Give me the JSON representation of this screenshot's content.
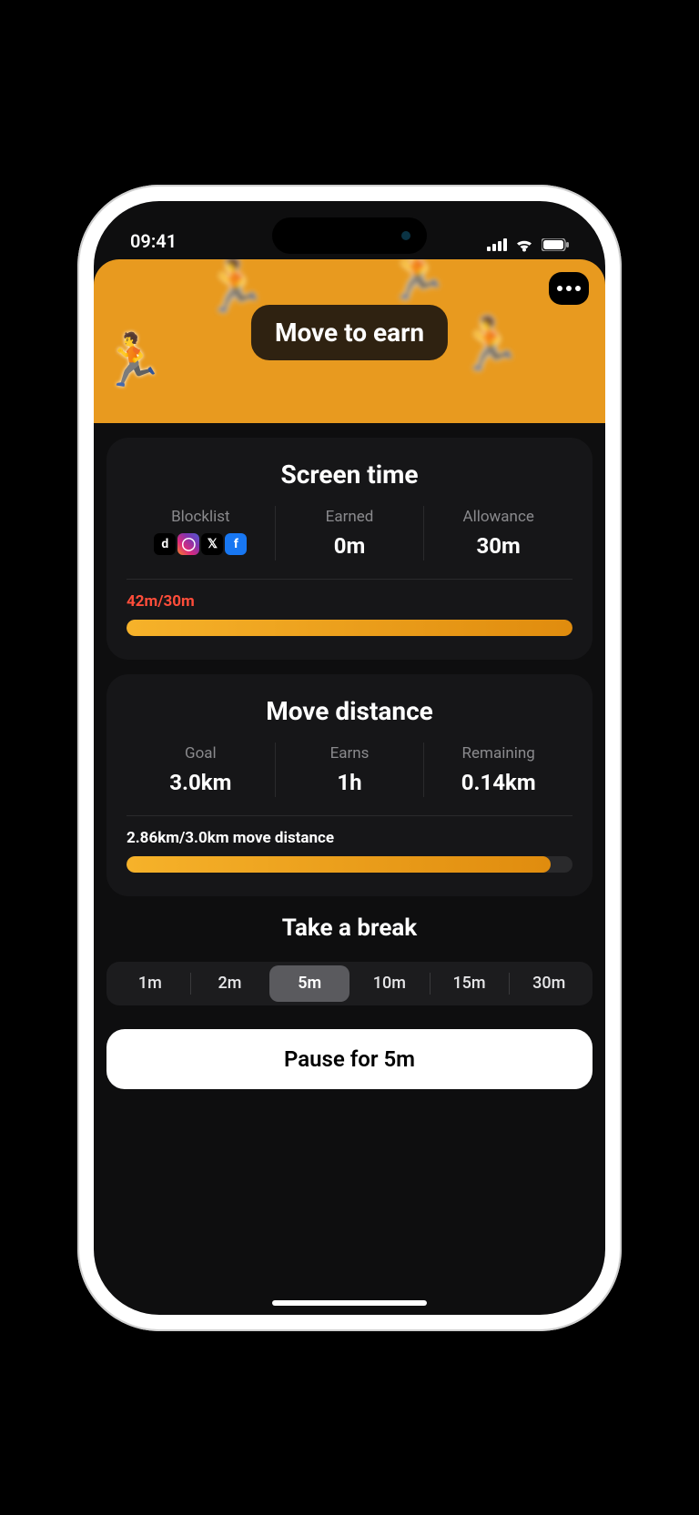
{
  "status": {
    "time": "09:41"
  },
  "hero": {
    "title": "Move to earn"
  },
  "screen_time": {
    "title": "Screen time",
    "blocklist_label": "Blocklist",
    "blocklist_apps": [
      "tiktok",
      "instagram",
      "x",
      "facebook"
    ],
    "earned_label": "Earned",
    "earned_value": "0m",
    "allowance_label": "Allowance",
    "allowance_value": "30m",
    "progress_label": "42m/30m",
    "progress_pct": 100
  },
  "move": {
    "title": "Move distance",
    "goal_label": "Goal",
    "goal_value": "3.0km",
    "earns_label": "Earns",
    "earns_value": "1h",
    "remaining_label": "Remaining",
    "remaining_value": "0.14km",
    "progress_label": "2.86km/3.0km move distance",
    "progress_pct": 95
  },
  "break": {
    "title": "Take a break",
    "options": [
      "1m",
      "2m",
      "5m",
      "10m",
      "15m",
      "30m"
    ],
    "selected_index": 2,
    "pause_label": "Pause for 5m"
  }
}
